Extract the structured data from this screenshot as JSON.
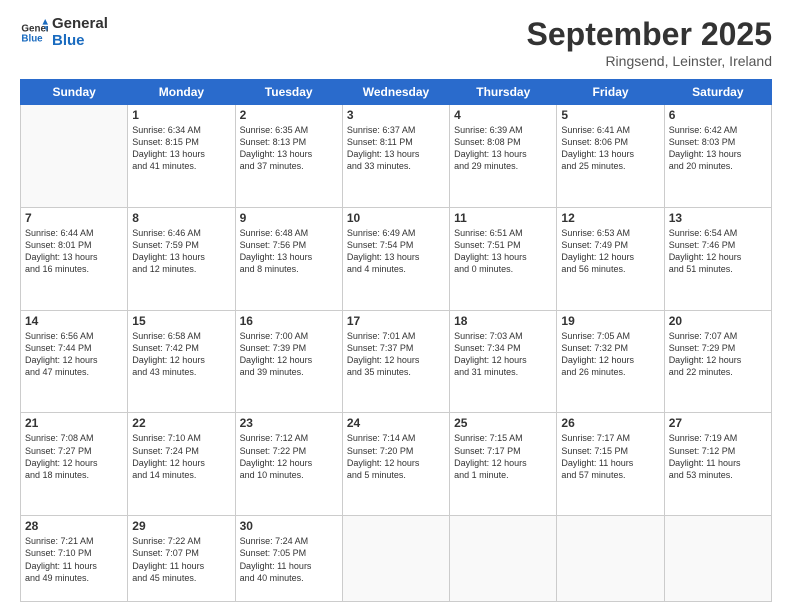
{
  "header": {
    "logo_line1": "General",
    "logo_line2": "Blue",
    "month": "September 2025",
    "location": "Ringsend, Leinster, Ireland"
  },
  "weekdays": [
    "Sunday",
    "Monday",
    "Tuesday",
    "Wednesday",
    "Thursday",
    "Friday",
    "Saturday"
  ],
  "weeks": [
    [
      {
        "day": "",
        "info": ""
      },
      {
        "day": "1",
        "info": "Sunrise: 6:34 AM\nSunset: 8:15 PM\nDaylight: 13 hours\nand 41 minutes."
      },
      {
        "day": "2",
        "info": "Sunrise: 6:35 AM\nSunset: 8:13 PM\nDaylight: 13 hours\nand 37 minutes."
      },
      {
        "day": "3",
        "info": "Sunrise: 6:37 AM\nSunset: 8:11 PM\nDaylight: 13 hours\nand 33 minutes."
      },
      {
        "day": "4",
        "info": "Sunrise: 6:39 AM\nSunset: 8:08 PM\nDaylight: 13 hours\nand 29 minutes."
      },
      {
        "day": "5",
        "info": "Sunrise: 6:41 AM\nSunset: 8:06 PM\nDaylight: 13 hours\nand 25 minutes."
      },
      {
        "day": "6",
        "info": "Sunrise: 6:42 AM\nSunset: 8:03 PM\nDaylight: 13 hours\nand 20 minutes."
      }
    ],
    [
      {
        "day": "7",
        "info": "Sunrise: 6:44 AM\nSunset: 8:01 PM\nDaylight: 13 hours\nand 16 minutes."
      },
      {
        "day": "8",
        "info": "Sunrise: 6:46 AM\nSunset: 7:59 PM\nDaylight: 13 hours\nand 12 minutes."
      },
      {
        "day": "9",
        "info": "Sunrise: 6:48 AM\nSunset: 7:56 PM\nDaylight: 13 hours\nand 8 minutes."
      },
      {
        "day": "10",
        "info": "Sunrise: 6:49 AM\nSunset: 7:54 PM\nDaylight: 13 hours\nand 4 minutes."
      },
      {
        "day": "11",
        "info": "Sunrise: 6:51 AM\nSunset: 7:51 PM\nDaylight: 13 hours\nand 0 minutes."
      },
      {
        "day": "12",
        "info": "Sunrise: 6:53 AM\nSunset: 7:49 PM\nDaylight: 12 hours\nand 56 minutes."
      },
      {
        "day": "13",
        "info": "Sunrise: 6:54 AM\nSunset: 7:46 PM\nDaylight: 12 hours\nand 51 minutes."
      }
    ],
    [
      {
        "day": "14",
        "info": "Sunrise: 6:56 AM\nSunset: 7:44 PM\nDaylight: 12 hours\nand 47 minutes."
      },
      {
        "day": "15",
        "info": "Sunrise: 6:58 AM\nSunset: 7:42 PM\nDaylight: 12 hours\nand 43 minutes."
      },
      {
        "day": "16",
        "info": "Sunrise: 7:00 AM\nSunset: 7:39 PM\nDaylight: 12 hours\nand 39 minutes."
      },
      {
        "day": "17",
        "info": "Sunrise: 7:01 AM\nSunset: 7:37 PM\nDaylight: 12 hours\nand 35 minutes."
      },
      {
        "day": "18",
        "info": "Sunrise: 7:03 AM\nSunset: 7:34 PM\nDaylight: 12 hours\nand 31 minutes."
      },
      {
        "day": "19",
        "info": "Sunrise: 7:05 AM\nSunset: 7:32 PM\nDaylight: 12 hours\nand 26 minutes."
      },
      {
        "day": "20",
        "info": "Sunrise: 7:07 AM\nSunset: 7:29 PM\nDaylight: 12 hours\nand 22 minutes."
      }
    ],
    [
      {
        "day": "21",
        "info": "Sunrise: 7:08 AM\nSunset: 7:27 PM\nDaylight: 12 hours\nand 18 minutes."
      },
      {
        "day": "22",
        "info": "Sunrise: 7:10 AM\nSunset: 7:24 PM\nDaylight: 12 hours\nand 14 minutes."
      },
      {
        "day": "23",
        "info": "Sunrise: 7:12 AM\nSunset: 7:22 PM\nDaylight: 12 hours\nand 10 minutes."
      },
      {
        "day": "24",
        "info": "Sunrise: 7:14 AM\nSunset: 7:20 PM\nDaylight: 12 hours\nand 5 minutes."
      },
      {
        "day": "25",
        "info": "Sunrise: 7:15 AM\nSunset: 7:17 PM\nDaylight: 12 hours\nand 1 minute."
      },
      {
        "day": "26",
        "info": "Sunrise: 7:17 AM\nSunset: 7:15 PM\nDaylight: 11 hours\nand 57 minutes."
      },
      {
        "day": "27",
        "info": "Sunrise: 7:19 AM\nSunset: 7:12 PM\nDaylight: 11 hours\nand 53 minutes."
      }
    ],
    [
      {
        "day": "28",
        "info": "Sunrise: 7:21 AM\nSunset: 7:10 PM\nDaylight: 11 hours\nand 49 minutes."
      },
      {
        "day": "29",
        "info": "Sunrise: 7:22 AM\nSunset: 7:07 PM\nDaylight: 11 hours\nand 45 minutes."
      },
      {
        "day": "30",
        "info": "Sunrise: 7:24 AM\nSunset: 7:05 PM\nDaylight: 11 hours\nand 40 minutes."
      },
      {
        "day": "",
        "info": ""
      },
      {
        "day": "",
        "info": ""
      },
      {
        "day": "",
        "info": ""
      },
      {
        "day": "",
        "info": ""
      }
    ]
  ]
}
